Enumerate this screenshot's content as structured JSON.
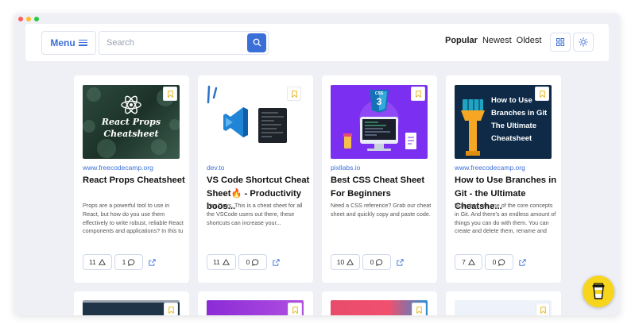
{
  "header": {
    "menu_label": "Menu",
    "search_placeholder": "Search",
    "sort": [
      {
        "label": "Popular",
        "active": true
      },
      {
        "label": "Newest",
        "active": false
      },
      {
        "label": "Oldest",
        "active": false
      }
    ],
    "icons": [
      "grid-icon",
      "sun-icon"
    ]
  },
  "cards": [
    {
      "thumb_text": "React Props Cheatsheet",
      "source": "www.freecodecamp.org",
      "title": "React Props Cheatsheet",
      "description": "Props are a powerful tool to use in React, but how do you use them effectively to write robust, reliable React components and applications? In this tu",
      "upvotes": "11",
      "comments": "1"
    },
    {
      "thumb_text": "",
      "source": "dev.to",
      "title": "VS Code Shortcut Cheat Sheet🔥 - Productivity boos...",
      "description": "Hey Devs, This is a cheat sheet for all the VSCode users out there, these shortcuts can increase your...",
      "upvotes": "11",
      "comments": "0"
    },
    {
      "thumb_text": "CSS",
      "source": "pixllabs.io",
      "title": "Best CSS Cheat Sheet For Beginners",
      "description": "Need a CSS reference? Grab our cheat sheet and quickly copy and paste code.",
      "upvotes": "10",
      "comments": "0"
    },
    {
      "thumb_text": "How to Use Branches in Git The Ultimate Cheatsheet",
      "source": "www.freecodecamp.org",
      "title": "How to Use Branches in Git - the Ultimate Cheatshe...",
      "description": "Branches are one of the core concepts in Git. And there's an endless amount of things you can do with them. You can create and delete them, rename and",
      "upvotes": "7",
      "comments": "0"
    }
  ],
  "colors": {
    "accent": "#3b6fd8",
    "fab": "#f7d51d",
    "bookmark": "#e8b923"
  }
}
